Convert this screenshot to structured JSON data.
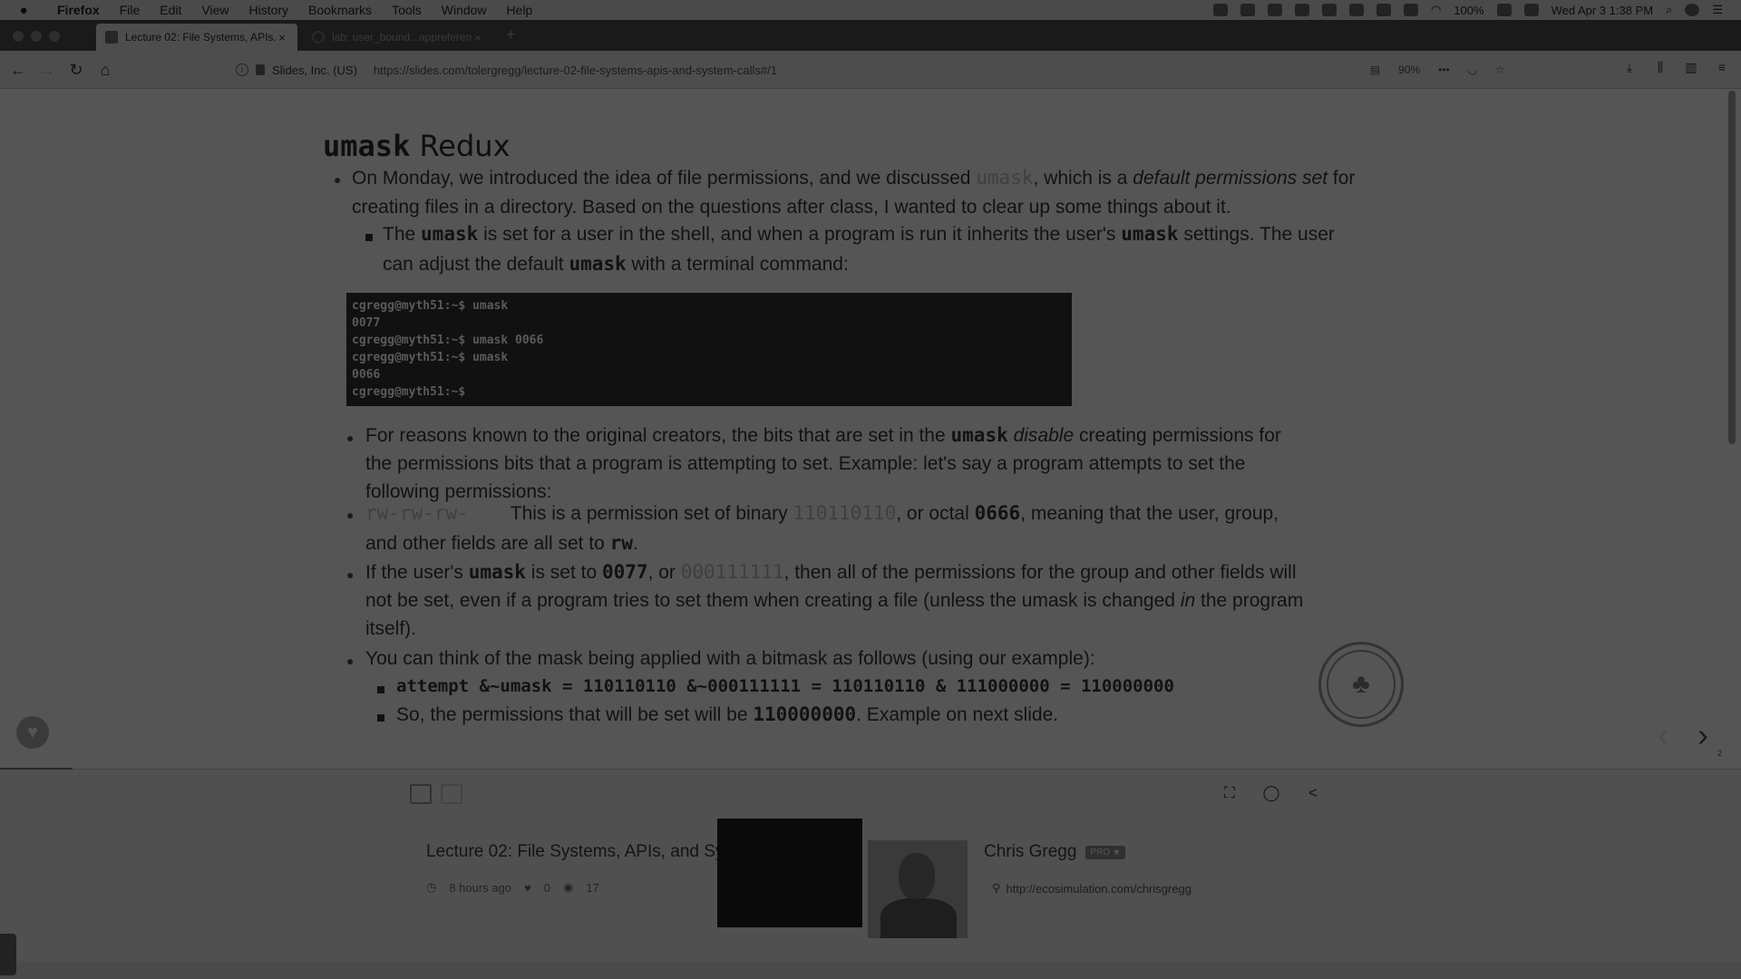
{
  "menubar": {
    "apple": "",
    "items": [
      "Firefox",
      "File",
      "Edit",
      "View",
      "History",
      "Bookmarks",
      "Tools",
      "Window",
      "Help"
    ],
    "battery": "100%",
    "clock": "Wed Apr 3  1:38 PM"
  },
  "tabs": [
    {
      "label": "Lecture 02: File Systems, APIs...",
      "close": "×"
    },
    {
      "label": "lab: user_bound...appreferen...",
      "close": "×"
    }
  ],
  "newtab": "+",
  "nav": {
    "back": "←",
    "forward": "→",
    "reload": "↻",
    "home": "⌂",
    "org": "Slides, Inc. (US)",
    "url": "https://slides.com/tolergregg/lecture-02-file-systems-apis-and-system-calls#/1",
    "zoom": "90%",
    "more": "•••"
  },
  "slide": {
    "title_code": "umask",
    "title_rest": " Redux",
    "p1a": "On Monday, we introduced the idea of file permissions, and we discussed ",
    "p1_code": "umask",
    "p1b": ", which is a ",
    "p1_em": "default permissions set",
    "p1c": " for",
    "p1_line2": "creating files in a directory. Based on the questions after class, I wanted to clear up some things about it.",
    "s1a": "The ",
    "s1_code1": "umask",
    "s1b": " is set for a user in the shell, and when a program is run it inherits the user's ",
    "s1_code2": "umask",
    "s1c": " settings. The user",
    "s1_line2a": "can adjust the default ",
    "s1_code3": "umask",
    "s1_line2b": " with a terminal command:",
    "terminal": [
      "cgregg@myth51:~$ umask",
      "0077",
      "cgregg@myth51:~$ umask 0066",
      "cgregg@myth51:~$ umask",
      "0066",
      "cgregg@myth51:~$"
    ],
    "b2a": "For reasons known to the original creators, the bits that are set in the ",
    "b2_code": "umask",
    "b2_em": " disable",
    "b2b": " creating permissions for",
    "b2_line2": "the permissions bits that a program is attempting to set. Example: let's say a program attempts to set the",
    "b2_line3": "following permissions:",
    "b3_code": "rw-rw-rw-",
    "b3a": "This is a permission set of binary ",
    "b3_bin": "110110110",
    "b3b": ", or octal ",
    "b3_oct": "0666",
    "b3c": ", meaning that the user, group,",
    "b3_line2a": "and other fields are all set to ",
    "b3_rw": "rw",
    "b3_line2b": ".",
    "b4a": "If the user's ",
    "b4_code": "umask",
    "b4b": " is set to ",
    "b4_oct": "0077",
    "b4c": ", or ",
    "b4_bin": "000111111",
    "b4d": ", then all of the permissions for the group and other fields will",
    "b4_line2a": "not be set, even if a program tries to set them when creating a file (unless the umask is changed ",
    "b4_em": "in",
    "b4_line2b": " the program",
    "b4_line3": "itself).",
    "b5": "You can think of the mask being applied with a bitmask as follows (using our example):",
    "b5_code": "attempt &~umask = 110110110 &~000111111 = 110110110 & 111000000 = 110000000",
    "b6a": "So, the permissions that will be set will be ",
    "b6_code": "110000000",
    "b6b": ". Example on next slide."
  },
  "controls": {
    "like": "♥",
    "prev": "‹",
    "next": "›",
    "slide_number": "2"
  },
  "footer": {
    "deck_title": "Lecture 02: File Systems, APIs, and System Calls",
    "time_ago": "8 hours ago",
    "likes": "0",
    "views": "17",
    "author": "Chris Gregg",
    "badge": "PRO ★",
    "author_url": "http://ecosimulation.com/chrisgregg"
  }
}
